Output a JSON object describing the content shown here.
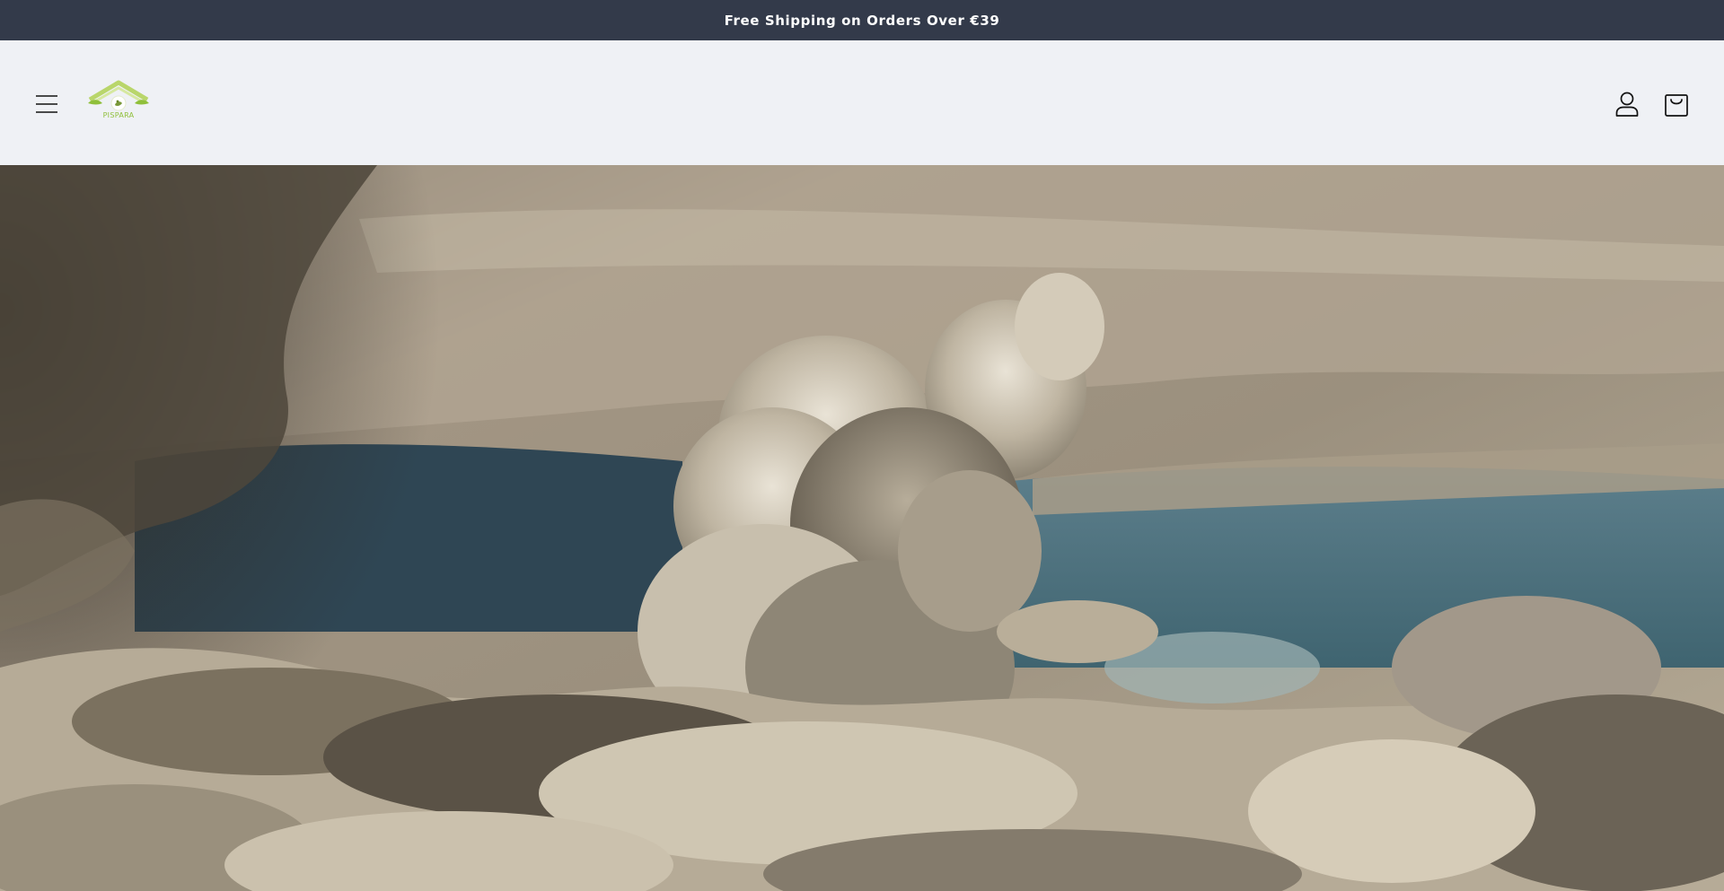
{
  "announcement": {
    "text": "Free Shipping on Orders Over €39"
  },
  "header": {
    "logo": {
      "text": "PISPARA"
    },
    "icons": {
      "menu": "hamburger-menu-icon",
      "account": "account-user-icon",
      "cart": "shopping-cart-icon"
    }
  },
  "colors": {
    "announcement_bg": "#333a4a",
    "header_bg": "#eff1f5",
    "icon_color": "#121212",
    "logo_green": "#8fbf3a"
  }
}
